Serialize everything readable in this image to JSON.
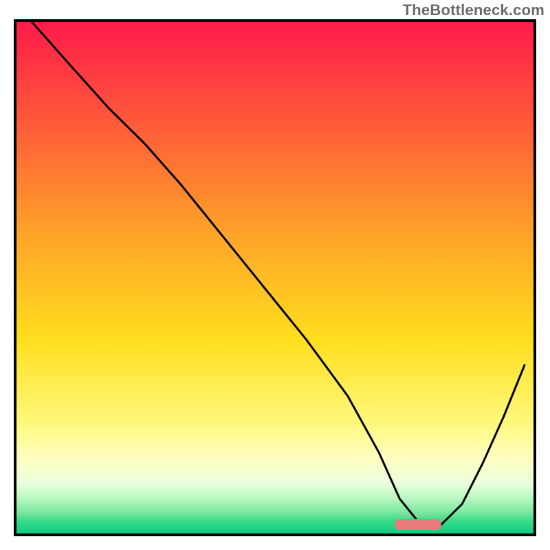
{
  "watermark": "TheBottleneck.com",
  "chart_data": {
    "type": "line",
    "title": "",
    "xlabel": "",
    "ylabel": "",
    "xlim": [
      0,
      100
    ],
    "ylim": [
      0,
      100
    ],
    "annotations": [],
    "background_gradient_stops": [
      {
        "offset": 0.0,
        "color": "#ff1a4b"
      },
      {
        "offset": 0.2,
        "color": "#ff5a3a"
      },
      {
        "offset": 0.42,
        "color": "#ffa528"
      },
      {
        "offset": 0.62,
        "color": "#ffde1e"
      },
      {
        "offset": 0.78,
        "color": "#fff87a"
      },
      {
        "offset": 0.85,
        "color": "#ffffc0"
      },
      {
        "offset": 0.9,
        "color": "#eaffde"
      },
      {
        "offset": 0.93,
        "color": "#b6f7c0"
      },
      {
        "offset": 0.955,
        "color": "#7de8a0"
      },
      {
        "offset": 0.975,
        "color": "#35d989"
      },
      {
        "offset": 1.0,
        "color": "#0acc80"
      }
    ],
    "target_band": {
      "x_start": 73,
      "x_end": 82,
      "y": 2,
      "color": "#e77a7a"
    },
    "series": [
      {
        "name": "bottleneck-curve",
        "color": "#000000",
        "x": [
          3,
          10,
          18,
          25,
          32,
          40,
          48,
          56,
          64,
          70,
          74,
          78,
          82,
          86,
          90,
          94,
          98
        ],
        "y": [
          100,
          92,
          83,
          76,
          68,
          58,
          48,
          38,
          27,
          16,
          7,
          2,
          2,
          6,
          14,
          23,
          33
        ]
      }
    ]
  }
}
